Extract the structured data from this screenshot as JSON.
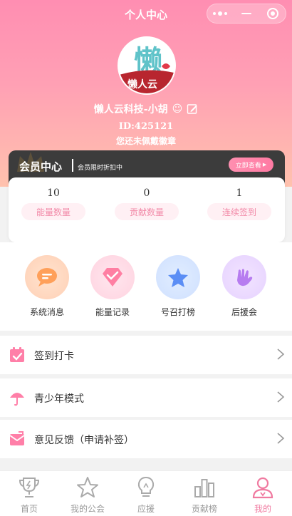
{
  "header": {
    "title": "个人中心",
    "capsule": {
      "icons": [
        "more-icon",
        "minimize-icon",
        "close-target-icon"
      ]
    }
  },
  "profile": {
    "avatar_text": "懒人云",
    "username": "懒人云科技-小胡",
    "emoji": "☺",
    "id_text": "ID:425121",
    "badge_text": "您还未佩戴徽章"
  },
  "member": {
    "title": "会员中心",
    "subtitle": "会员限时折扣中",
    "button": "立即查看"
  },
  "stats": [
    {
      "value": "10",
      "label": "能量数量"
    },
    {
      "value": "0",
      "label": "贡献数量"
    },
    {
      "value": "1",
      "label": "连续签到"
    }
  ],
  "grid": [
    {
      "label": "系统消息",
      "icon": "message-icon"
    },
    {
      "label": "能量记录",
      "icon": "diamond-icon"
    },
    {
      "label": "号召打榜",
      "icon": "star-icon"
    },
    {
      "label": "后援会",
      "icon": "hand-icon"
    }
  ],
  "list": [
    {
      "label": "签到打卡",
      "icon": "calendar-check-icon"
    },
    {
      "label": "青少年模式",
      "icon": "umbrella-icon"
    },
    {
      "label": "意见反馈（申请补签）",
      "icon": "mail-icon"
    }
  ],
  "tabbar": [
    {
      "label": "首页",
      "icon": "trophy-icon",
      "active": false
    },
    {
      "label": "我的公会",
      "icon": "star-outline-icon",
      "active": false
    },
    {
      "label": "应援",
      "icon": "lightbulb-icon",
      "active": false
    },
    {
      "label": "贡献榜",
      "icon": "bar-chart-icon",
      "active": false
    },
    {
      "label": "我的",
      "icon": "user-icon",
      "active": true
    }
  ],
  "colors": {
    "accent": "#f07aa0",
    "header_top": "#ff8eb2",
    "header_bottom": "#ffc2ae",
    "member_bg": "#3c3c3c"
  }
}
